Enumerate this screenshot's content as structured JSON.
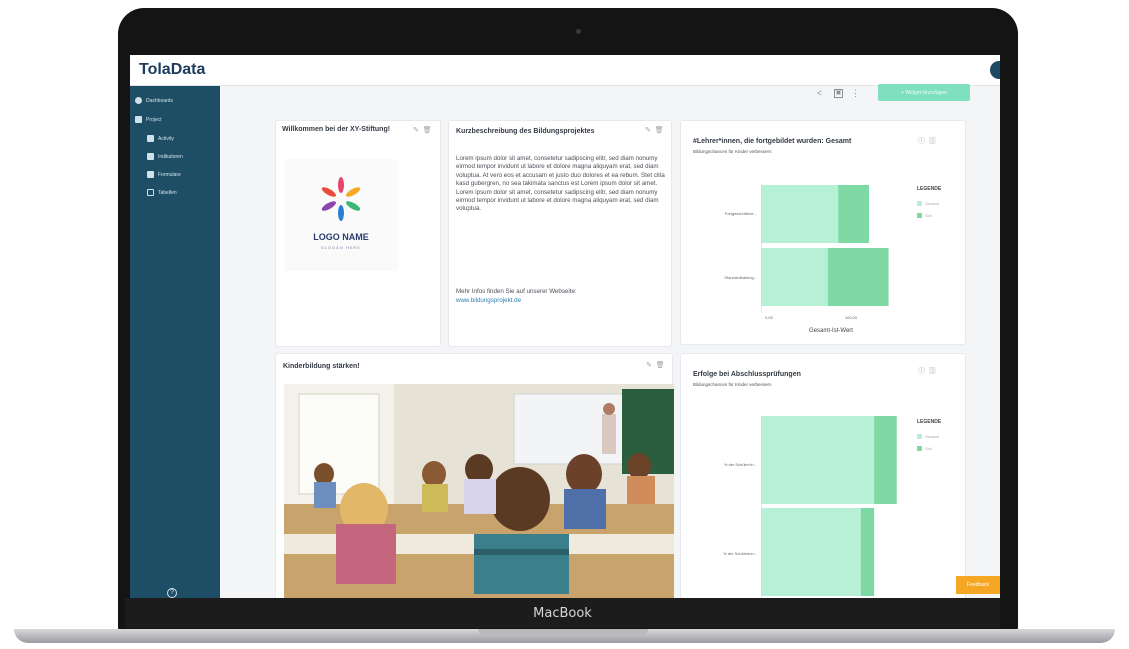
{
  "device": {
    "brand": "MacBook"
  },
  "app": {
    "name": "TolaData"
  },
  "sidebar": {
    "items": [
      {
        "label": "Dashboards",
        "icon": "gauge-icon"
      },
      {
        "label": "Project",
        "icon": "grid-icon"
      },
      {
        "label": "Activity",
        "icon": "grid-icon"
      },
      {
        "label": "Indikatoren",
        "icon": "bar-chart-icon"
      },
      {
        "label": "Formulare",
        "icon": "document-icon"
      },
      {
        "label": "Tabellen",
        "icon": "table-icon"
      }
    ],
    "help_icon_glyph": "?"
  },
  "toolbar": {
    "primary_button_label": "+ Widget hinzufügen",
    "icons": [
      "share-icon",
      "save-icon",
      "more-icon"
    ]
  },
  "cards": {
    "welcome": {
      "title": "Willkommen bei der XY-Stiftung!",
      "logo_name": "LOGO NAME",
      "logo_slogan": "SLOGAN HERE"
    },
    "description": {
      "title": "Kurzbeschreibung des Bildungsprojektes",
      "body": "Lorem ipsum dolor sit amet, consetetur sadipscing elitr, sed diam nonumy eirmod tempor invidunt ut labore et dolore magna aliquyam erat, sed diam voluptua. At vero eos et accusam et justo duo dolores et ea rebum. Stet clita kasd gubergren, no sea takimata sanctus est Lorem ipsum dolor sit amet. Lorem ipsum dolor sit amet, consetetur sadipscing elitr, sed diam nonumy eirmod tempor invidunt ut labore et dolore magna aliquyam erat, sed diam voluptua.",
      "more_info": "Mehr Infos finden Sie auf unserer Webseite:",
      "link": "www.bildungsprojekt.de"
    },
    "chart1": {
      "title": "#Lehrer*innen, die fortgebildet wurden: Gesamt",
      "subtitle": "Bildungschancen für Kinder verbessern",
      "legend_title": "LEGENDE",
      "legend_items": [
        "Gesamt",
        "Soll"
      ],
      "xlabel": "Gesamt-Ist-Wert",
      "ticks": [
        "0,00",
        "100,00"
      ]
    },
    "image": {
      "title": "Kinderbildung stärken!"
    },
    "chart2": {
      "title": "Erfolge bei Abschlussprüfungen",
      "subtitle": "Bildungschancen für Kinder verbessern",
      "legend_title": "LEGENDE",
      "legend_items": [
        "Gesamt",
        "Soll"
      ]
    }
  },
  "badge": {
    "label": "Feedback"
  },
  "colors": {
    "sidebar": "#1e4e66",
    "bar_light": "#b6f1d5",
    "bar_dark": "#7fd9a4",
    "accent": "#7fe0c0"
  },
  "chart_data": [
    {
      "type": "bar",
      "orientation": "horizontal",
      "categories": [
        "Fortgeschrittene...",
        "Standardtraining..."
      ],
      "series": [
        {
          "name": "Gesamt",
          "values": [
            75,
            65
          ]
        },
        {
          "name": "Soll",
          "values": [
            30,
            59
          ]
        }
      ],
      "stacked": true,
      "title": "#Lehrer*innen, die fortgebildet wurden: Gesamt",
      "xlabel": "Gesamt-Ist-Wert",
      "ticks": [
        "0,00",
        "100,00"
      ],
      "xlim": [
        0,
        140
      ],
      "legend": "right"
    },
    {
      "type": "bar",
      "orientation": "horizontal",
      "categories": [
        "% der Schüler*in...",
        "% der Schülerinn..."
      ],
      "series": [
        {
          "name": "Gesamt",
          "values": [
            110,
            97
          ]
        },
        {
          "name": "Soll",
          "values": [
            22,
            13
          ]
        }
      ],
      "stacked": true,
      "title": "Erfolge bei Abschlussprüfungen",
      "xlim": [
        0,
        140
      ],
      "legend": "right"
    }
  ]
}
